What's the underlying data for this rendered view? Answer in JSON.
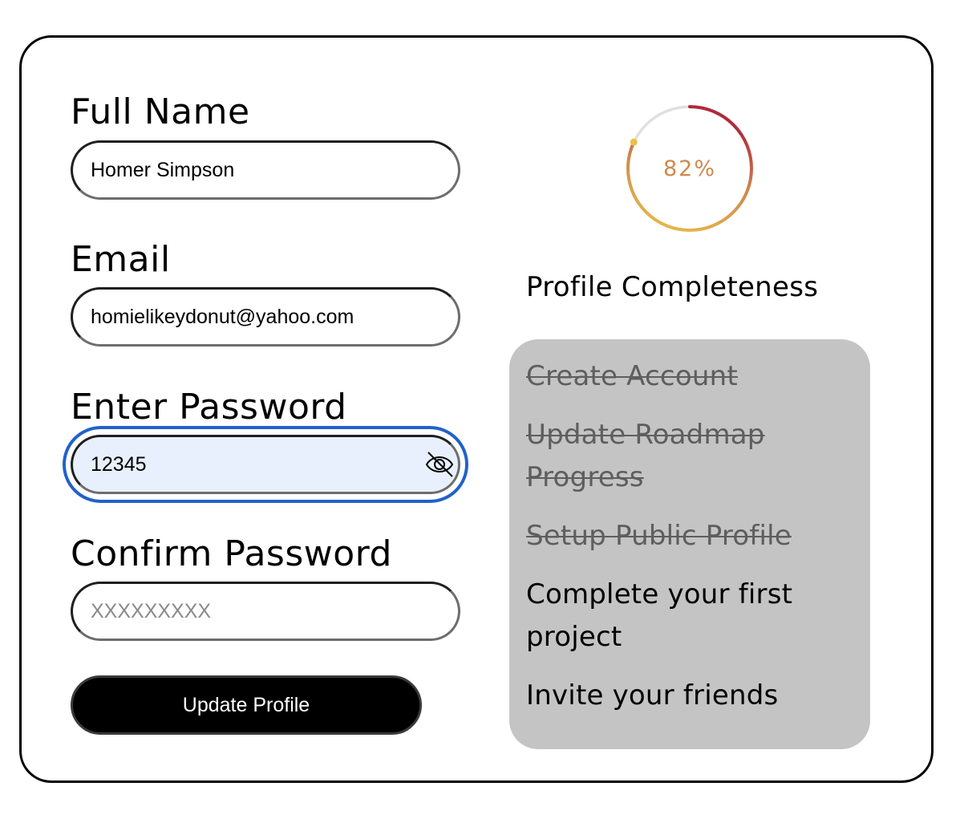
{
  "form": {
    "full_name": {
      "label": "Full Name",
      "value": "Homer Simpson"
    },
    "email": {
      "label": "Email",
      "value": "homielikeydonut@yahoo.com"
    },
    "password": {
      "label": "Enter Password",
      "value": "12345"
    },
    "confirm_password": {
      "label": "Confirm Password",
      "value": "",
      "placeholder": "XXXXXXXXX"
    },
    "submit_label": "Update Profile"
  },
  "profile": {
    "completeness_percent": 82,
    "completeness_text": "82%",
    "title": "Profile Completeness",
    "ring_colors": {
      "start": "#e8c24a",
      "mid": "#d0894e",
      "end": "#b02a3c",
      "track": "#e0e0e0"
    },
    "checklist": [
      {
        "label": "Create Account",
        "done": true
      },
      {
        "label": "Update Roadmap Progress",
        "done": true
      },
      {
        "label": "Setup Public Profile",
        "done": true
      },
      {
        "label": "Complete your first project",
        "done": false
      },
      {
        "label": "Invite your friends",
        "done": false
      }
    ]
  },
  "icons": {
    "password_toggle": "eye-off-icon"
  }
}
